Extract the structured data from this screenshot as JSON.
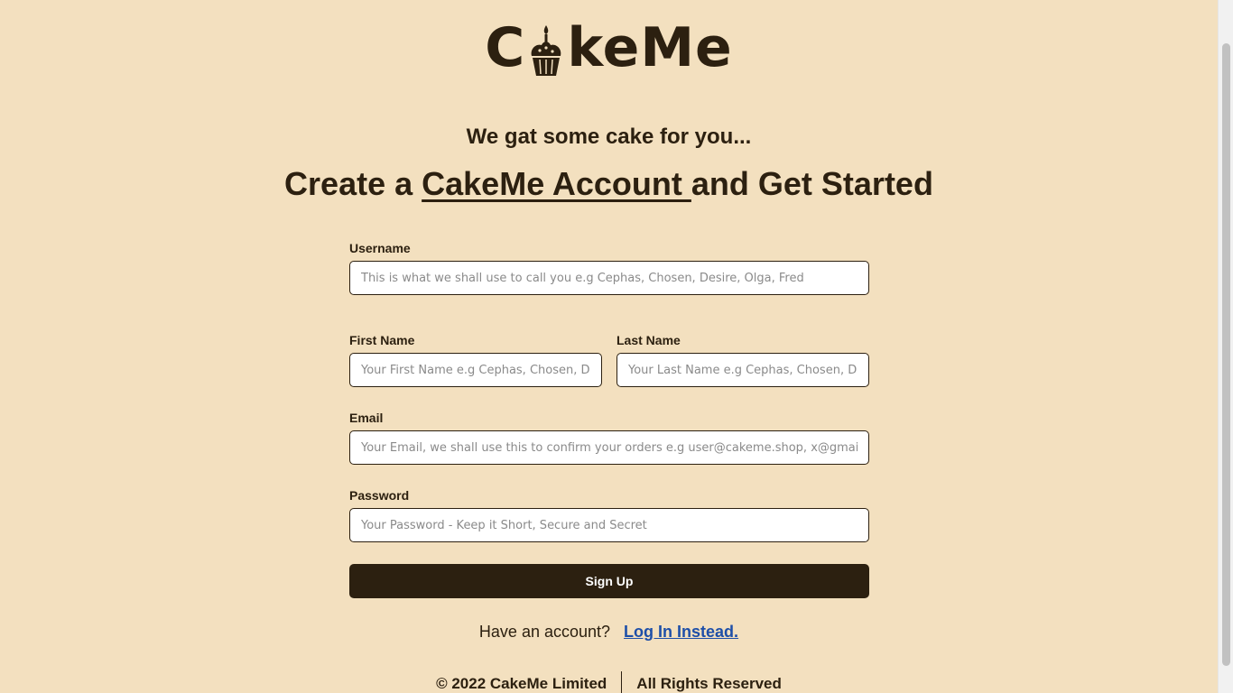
{
  "logo": {
    "text_before": "C",
    "text_after": "keMe",
    "icon": "cupcake-icon"
  },
  "tagline": "We gat some cake for you...",
  "headline": {
    "prefix": "Create a ",
    "linked": "CakeMe Account ",
    "suffix": "and Get Started"
  },
  "form": {
    "username": {
      "label": "Username",
      "placeholder": "This is what we shall use to call you e.g Cephas, Chosen, Desire, Olga, Fred"
    },
    "first_name": {
      "label": "First Name",
      "placeholder": "Your First Name e.g Cephas, Chosen, Desire, Olga, Fred"
    },
    "last_name": {
      "label": "Last Name",
      "placeholder": "Your Last Name e.g Cephas, Chosen, Desire, Olga, Fred"
    },
    "email": {
      "label": "Email",
      "placeholder": "Your Email, we shall use this to confirm your orders e.g user@cakeme.shop, x@gmail.com"
    },
    "password": {
      "label": "Password",
      "placeholder": "Your Password - Keep it Short, Secure and Secret"
    },
    "submit_label": "Sign Up"
  },
  "login_prompt": {
    "text": "Have an account?",
    "link_label": "Log In Instead."
  },
  "footer": {
    "copyright": "© 2022 CakeMe Limited",
    "rights": "All Rights Reserved"
  },
  "colors": {
    "background": "#f3e0bf",
    "brand_dark": "#2c2010",
    "link": "#1e4fa8"
  }
}
